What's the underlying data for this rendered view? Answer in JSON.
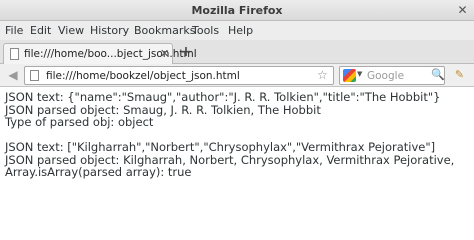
{
  "window": {
    "title": "Mozilla Firefox",
    "close_glyph": "✕"
  },
  "menubar": {
    "items": [
      "File",
      "Edit",
      "View",
      "History",
      "Bookmarks",
      "Tools",
      "Help"
    ]
  },
  "tab": {
    "title": "file:///home/boo...bject_json.html",
    "close_glyph": "✕",
    "new_tab_glyph": "+"
  },
  "navbar": {
    "back_glyph": "◀",
    "url": "file:///home/bookzel/object_json.html",
    "star_glyph": "☆",
    "reload_glyph": "↻",
    "search_placeholder": "Google",
    "search_dropdown_glyph": "▼",
    "search_go_glyph": "🔍",
    "addon_glyph": "✎"
  },
  "content": {
    "block1": [
      "JSON text: {\"name\":\"Smaug\",\"author\":\"J. R. R. Tolkien\",\"title\":\"The Hobbit\"}",
      "JSON parsed object: Smaug, J. R. R. Tolkien, The Hobbit",
      "Type of parsed obj: object"
    ],
    "block2": [
      "JSON text: [\"Kilgharrah\",\"Norbert\",\"Chrysophylax\",\"Vermithrax Pejorative\"]",
      "JSON parsed object: Kilgharrah, Norbert, Chrysophylax, Vermithrax Pejorative,",
      "Array.isArray(parsed array): true"
    ]
  }
}
